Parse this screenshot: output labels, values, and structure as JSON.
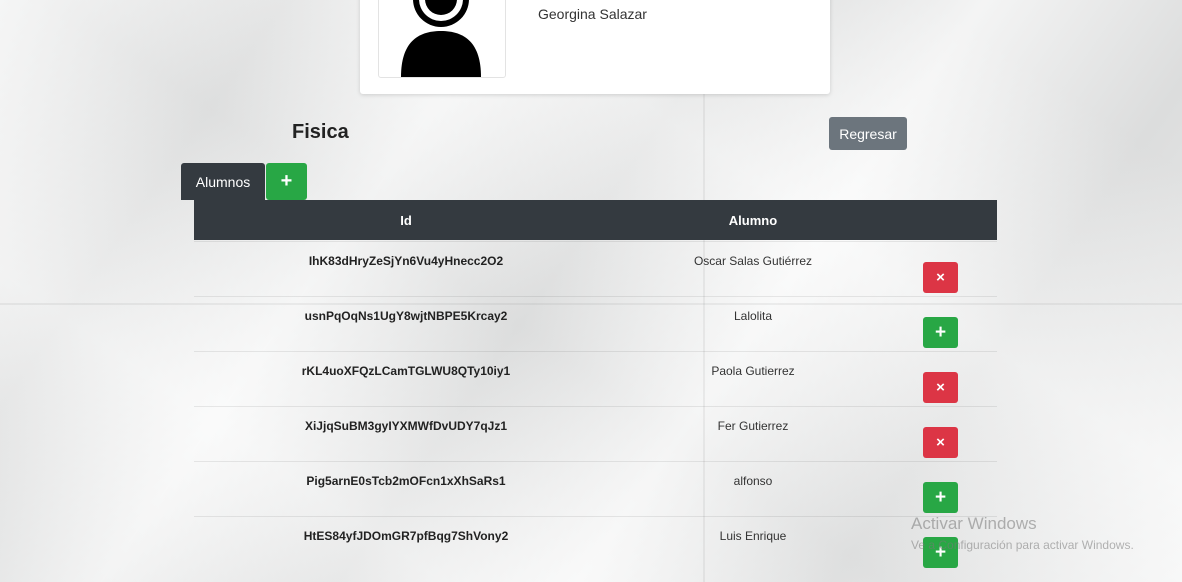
{
  "card": {
    "teacher_name": "Georgina Salazar",
    "avatar_icon": "user-silhouette-icon"
  },
  "subject": {
    "title": "Fisica"
  },
  "buttons": {
    "back_label": "Regresar",
    "tab_label": "Alumnos",
    "add_symbol": "+"
  },
  "table": {
    "headers": [
      "Id",
      "Alumno"
    ],
    "rows": [
      {
        "id": "IhK83dHryZeSjYn6Vu4yHnecc2O2",
        "name": "Oscar Salas Gutiérrez",
        "action": "×",
        "action_type": "remove"
      },
      {
        "id": "usnPqOqNs1UgY8wjtNBPE5Krcay2",
        "name": "Lalolita",
        "action": "+",
        "action_type": "add"
      },
      {
        "id": "rKL4uoXFQzLCamTGLWU8QTy10iy1",
        "name": "Paola Gutierrez",
        "action": "×",
        "action_type": "remove"
      },
      {
        "id": "XiJjqSuBM3gyIYXMWfDvUDY7qJz1",
        "name": "Fer Gutierrez",
        "action": "×",
        "action_type": "remove"
      },
      {
        "id": "Pig5arnE0sTcb2mOFcn1xXhSaRs1",
        "name": "alfonso",
        "action": "+",
        "action_type": "add"
      },
      {
        "id": "HtES84yfJDOmGR7pfBqg7ShVony2",
        "name": "Luis Enrique",
        "action": "+",
        "action_type": "add"
      }
    ]
  },
  "watermark": {
    "title": "Activar Windows",
    "subtitle": "Ve a Configuración para activar Windows."
  },
  "colors": {
    "dark": "#343a40",
    "success": "#28a745",
    "danger": "#dc3545",
    "secondary": "#6c757d"
  }
}
